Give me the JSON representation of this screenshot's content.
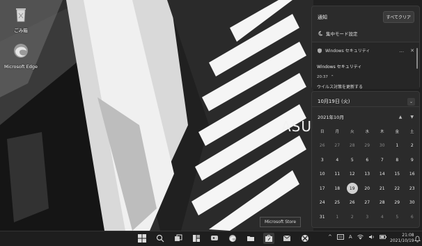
{
  "desktop": {
    "icons": [
      {
        "label": "ごみ箱",
        "icon": "recycle-bin-icon"
      },
      {
        "label": "Microsoft Edge",
        "icon": "edge-icon"
      }
    ],
    "wallpaper_brand": "ASUS"
  },
  "notifications": {
    "title": "通知",
    "clear_all": "すべてクリア",
    "focus_mode": "集中モード設定",
    "card": {
      "app": "Windows セキュリティ",
      "title": "Windows セキュリティ",
      "time": "20:37",
      "body": "ウイルス対策を更新する"
    }
  },
  "calendar": {
    "date_header": "10月19日 (火)",
    "month": "2021年10月",
    "weekdays": [
      "日",
      "月",
      "火",
      "水",
      "木",
      "金",
      "土"
    ],
    "days": [
      "26",
      "27",
      "28",
      "29",
      "30",
      "1",
      "2",
      "3",
      "4",
      "5",
      "6",
      "7",
      "8",
      "9",
      "10",
      "11",
      "12",
      "13",
      "14",
      "15",
      "16",
      "17",
      "18",
      "19",
      "20",
      "21",
      "22",
      "23",
      "24",
      "25",
      "26",
      "27",
      "28",
      "29",
      "30",
      "31",
      "1",
      "2",
      "3",
      "4",
      "5",
      "6"
    ],
    "today": "19",
    "dim_leading": 5,
    "dim_trailing": 6
  },
  "tooltip": "Microsoft Store",
  "taskbar": {
    "apps": [
      "start-icon",
      "search-icon",
      "task-view-icon",
      "widgets-icon",
      "chat-icon",
      "edge-icon",
      "file-explorer-icon",
      "microsoft-store-icon",
      "mail-icon",
      "xbox-icon"
    ],
    "tray_chevron": "^",
    "ime": "A",
    "clock_time": "21:08",
    "clock_date": "2021/10/19"
  },
  "colors": {
    "accent": "#d0d0d0",
    "panel": "#2b2b2b"
  }
}
